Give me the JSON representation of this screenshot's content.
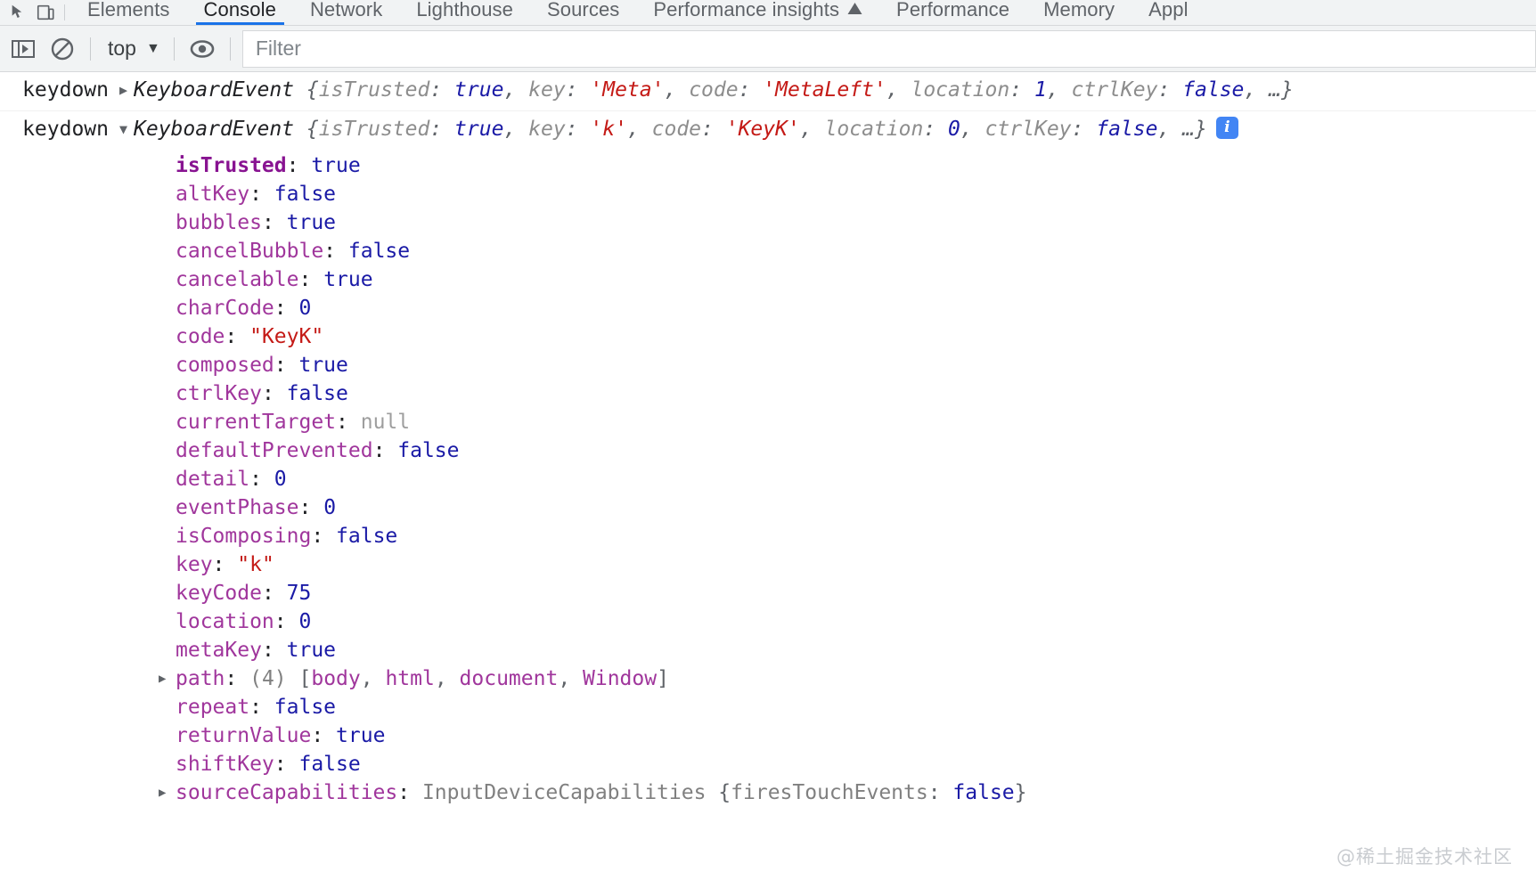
{
  "tabbar": {
    "left_icons": [
      {
        "name": "inspect-element-icon"
      },
      {
        "name": "device-toolbar-icon"
      }
    ],
    "tabs": [
      {
        "label": "Elements",
        "active": false
      },
      {
        "label": "Console",
        "active": true
      },
      {
        "label": "Network",
        "active": false
      },
      {
        "label": "Lighthouse",
        "active": false
      },
      {
        "label": "Sources",
        "active": false
      },
      {
        "label": "Performance insights",
        "active": false,
        "badge": "warning-triangle-icon"
      },
      {
        "label": "Performance",
        "active": false
      },
      {
        "label": "Memory",
        "active": false
      },
      {
        "label": "Appl",
        "active": false
      }
    ]
  },
  "toolbar": {
    "sidebar_toggle": "console-sidebar-icon",
    "clear_console": "clear-console-icon",
    "context": {
      "label": "top",
      "caret": "▼"
    },
    "eye": "live-expression-icon",
    "filter": {
      "placeholder": "Filter",
      "value": ""
    }
  },
  "console": {
    "messages": [
      {
        "label": "keydown",
        "arrow": "▶",
        "expanded": false,
        "ctor": "KeyboardEvent",
        "preview": [
          {
            "t": "brace",
            "v": " {"
          },
          {
            "t": "pname",
            "v": "isTrusted"
          },
          {
            "t": "brace",
            "v": ": "
          },
          {
            "t": "vbool",
            "v": "true"
          },
          {
            "t": "brace",
            "v": ", "
          },
          {
            "t": "pname",
            "v": "key"
          },
          {
            "t": "brace",
            "v": ": "
          },
          {
            "t": "vstr",
            "v": "'Meta'"
          },
          {
            "t": "brace",
            "v": ", "
          },
          {
            "t": "pname",
            "v": "code"
          },
          {
            "t": "brace",
            "v": ": "
          },
          {
            "t": "vstr",
            "v": "'MetaLeft'"
          },
          {
            "t": "brace",
            "v": ", "
          },
          {
            "t": "pname",
            "v": "location"
          },
          {
            "t": "brace",
            "v": ": "
          },
          {
            "t": "vnum",
            "v": "1"
          },
          {
            "t": "brace",
            "v": ", "
          },
          {
            "t": "pname",
            "v": "ctrlKey"
          },
          {
            "t": "brace",
            "v": ": "
          },
          {
            "t": "vbool",
            "v": "false"
          },
          {
            "t": "brace",
            "v": ", …}"
          }
        ],
        "info_badge": null
      },
      {
        "label": "keydown",
        "arrow": "▼",
        "expanded": true,
        "ctor": "KeyboardEvent",
        "preview": [
          {
            "t": "brace",
            "v": " {"
          },
          {
            "t": "pname",
            "v": "isTrusted"
          },
          {
            "t": "brace",
            "v": ": "
          },
          {
            "t": "vbool",
            "v": "true"
          },
          {
            "t": "brace",
            "v": ", "
          },
          {
            "t": "pname",
            "v": "key"
          },
          {
            "t": "brace",
            "v": ": "
          },
          {
            "t": "vstr",
            "v": "'k'"
          },
          {
            "t": "brace",
            "v": ", "
          },
          {
            "t": "pname",
            "v": "code"
          },
          {
            "t": "brace",
            "v": ": "
          },
          {
            "t": "vstr",
            "v": "'KeyK'"
          },
          {
            "t": "brace",
            "v": ", "
          },
          {
            "t": "pname",
            "v": "location"
          },
          {
            "t": "brace",
            "v": ": "
          },
          {
            "t": "vnum",
            "v": "0"
          },
          {
            "t": "brace",
            "v": ", "
          },
          {
            "t": "pname",
            "v": "ctrlKey"
          },
          {
            "t": "brace",
            "v": ": "
          },
          {
            "t": "vbool",
            "v": "false"
          },
          {
            "t": "brace",
            "v": ", …}"
          }
        ],
        "info_badge": "i"
      }
    ],
    "properties": [
      {
        "tri": "",
        "key": "isTrusted",
        "own": true,
        "parts": [
          {
            "t": "b",
            "v": "true"
          }
        ]
      },
      {
        "tri": "",
        "key": "altKey",
        "own": false,
        "parts": [
          {
            "t": "b",
            "v": "false"
          }
        ]
      },
      {
        "tri": "",
        "key": "bubbles",
        "own": false,
        "parts": [
          {
            "t": "b",
            "v": "true"
          }
        ]
      },
      {
        "tri": "",
        "key": "cancelBubble",
        "own": false,
        "parts": [
          {
            "t": "b",
            "v": "false"
          }
        ]
      },
      {
        "tri": "",
        "key": "cancelable",
        "own": false,
        "parts": [
          {
            "t": "b",
            "v": "true"
          }
        ]
      },
      {
        "tri": "",
        "key": "charCode",
        "own": false,
        "parts": [
          {
            "t": "n",
            "v": "0"
          }
        ]
      },
      {
        "tri": "",
        "key": "code",
        "own": false,
        "parts": [
          {
            "t": "s",
            "v": "\"KeyK\""
          }
        ]
      },
      {
        "tri": "",
        "key": "composed",
        "own": false,
        "parts": [
          {
            "t": "b",
            "v": "true"
          }
        ]
      },
      {
        "tri": "",
        "key": "ctrlKey",
        "own": false,
        "parts": [
          {
            "t": "b",
            "v": "false"
          }
        ]
      },
      {
        "tri": "",
        "key": "currentTarget",
        "own": false,
        "parts": [
          {
            "t": "nul",
            "v": "null"
          }
        ]
      },
      {
        "tri": "",
        "key": "defaultPrevented",
        "own": false,
        "parts": [
          {
            "t": "b",
            "v": "false"
          }
        ]
      },
      {
        "tri": "",
        "key": "detail",
        "own": false,
        "parts": [
          {
            "t": "n",
            "v": "0"
          }
        ]
      },
      {
        "tri": "",
        "key": "eventPhase",
        "own": false,
        "parts": [
          {
            "t": "n",
            "v": "0"
          }
        ]
      },
      {
        "tri": "",
        "key": "isComposing",
        "own": false,
        "parts": [
          {
            "t": "b",
            "v": "false"
          }
        ]
      },
      {
        "tri": "",
        "key": "key",
        "own": false,
        "parts": [
          {
            "t": "s",
            "v": "\"k\""
          }
        ]
      },
      {
        "tri": "",
        "key": "keyCode",
        "own": false,
        "parts": [
          {
            "t": "n",
            "v": "75"
          }
        ]
      },
      {
        "tri": "",
        "key": "location",
        "own": false,
        "parts": [
          {
            "t": "n",
            "v": "0"
          }
        ]
      },
      {
        "tri": "",
        "key": "metaKey",
        "own": false,
        "parts": [
          {
            "t": "b",
            "v": "true"
          }
        ]
      },
      {
        "tri": "▶",
        "key": "path",
        "own": false,
        "parts": [
          {
            "t": "cnt",
            "v": "(4) "
          },
          {
            "t": "punc",
            "v": "["
          },
          {
            "t": "aitem",
            "v": "body"
          },
          {
            "t": "punc",
            "v": ", "
          },
          {
            "t": "aitem",
            "v": "html"
          },
          {
            "t": "punc",
            "v": ", "
          },
          {
            "t": "aitem",
            "v": "document"
          },
          {
            "t": "punc",
            "v": ", "
          },
          {
            "t": "aitem",
            "v": "Window"
          },
          {
            "t": "punc",
            "v": "]"
          }
        ]
      },
      {
        "tri": "",
        "key": "repeat",
        "own": false,
        "parts": [
          {
            "t": "b",
            "v": "false"
          }
        ]
      },
      {
        "tri": "",
        "key": "returnValue",
        "own": false,
        "parts": [
          {
            "t": "b",
            "v": "true"
          }
        ]
      },
      {
        "tri": "",
        "key": "shiftKey",
        "own": false,
        "parts": [
          {
            "t": "b",
            "v": "false"
          }
        ]
      },
      {
        "tri": "▶",
        "key": "sourceCapabilities",
        "own": false,
        "parts": [
          {
            "t": "cls",
            "v": "InputDeviceCapabilities "
          },
          {
            "t": "punc",
            "v": "{"
          },
          {
            "t": "cls",
            "v": "firesTouchEvents"
          },
          {
            "t": "punc",
            "v": ": "
          },
          {
            "t": "b",
            "v": "false"
          },
          {
            "t": "punc",
            "v": "}"
          }
        ]
      }
    ]
  },
  "watermark": "@稀土掘金技术社区"
}
